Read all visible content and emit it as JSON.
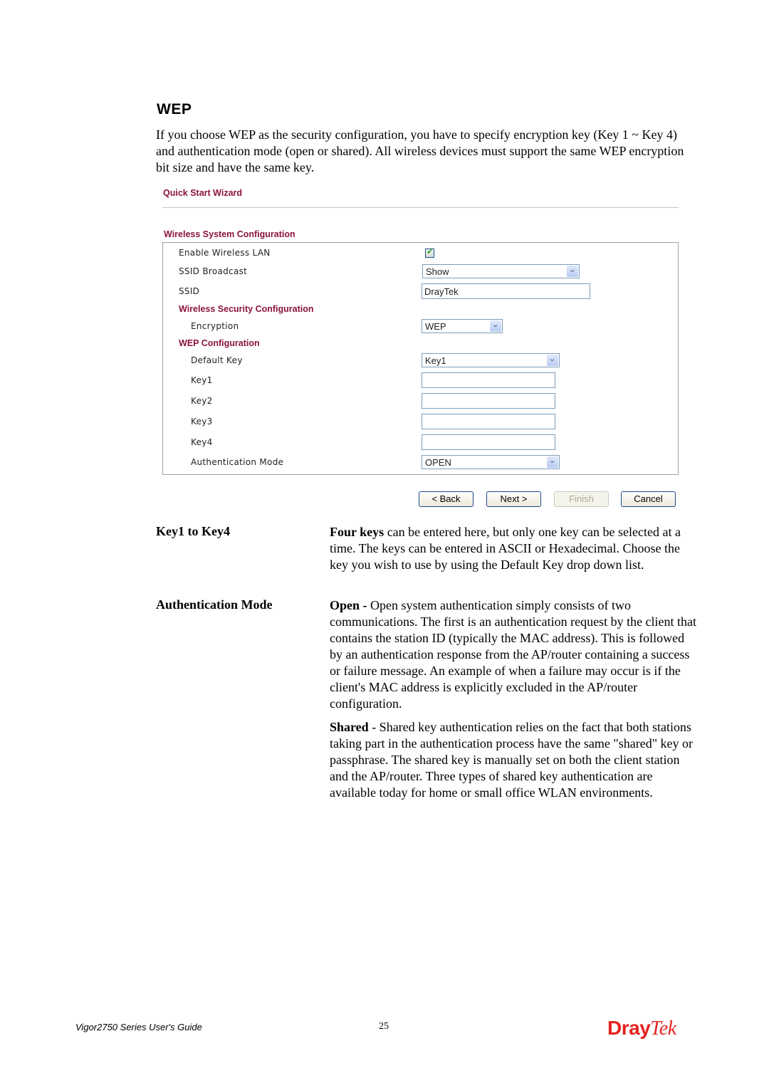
{
  "section": {
    "heading": "WEP",
    "intro": "If you choose WEP as the security configuration, you have to specify encryption key (Key 1 ~ Key 4) and authentication mode (open or shared). All wireless devices must support the same WEP encryption bit size and have the same key."
  },
  "wizard": {
    "title": "Quick Start Wizard",
    "system_section": "Wireless System Configuration",
    "security_section": "Wireless Security Configuration",
    "wep_section": "WEP Configuration",
    "fields": {
      "enable_wlan": {
        "label": "Enable Wireless LAN",
        "checked": true,
        "check_glyph": "✔"
      },
      "ssid_broadcast": {
        "label": "SSID Broadcast",
        "value": "Show"
      },
      "ssid": {
        "label": "SSID",
        "value": "DrayTek"
      },
      "encryption": {
        "label": "Encryption",
        "value": "WEP"
      },
      "default_key": {
        "label": "Default Key",
        "value": "Key1"
      },
      "key1": {
        "label": "Key1",
        "value": ""
      },
      "key2": {
        "label": "Key2",
        "value": ""
      },
      "key3": {
        "label": "Key3",
        "value": ""
      },
      "key4": {
        "label": "Key4",
        "value": ""
      },
      "auth_mode": {
        "label": "Authentication Mode",
        "value": "OPEN"
      }
    },
    "dropdown_glyph": "⌄",
    "buttons": {
      "back": "< Back",
      "next": "Next >",
      "finish": "Finish",
      "cancel": "Cancel"
    }
  },
  "definitions": {
    "keys": {
      "term": "Key1 to Key4",
      "bold": "Four keys",
      "text": " can be entered here, but only one key can be selected at a time. The keys can be entered in ASCII or Hexadecimal. Choose the key you wish to use by using the Default Key drop down list."
    },
    "auth": {
      "term": "Authentication Mode",
      "open_bold": "Open -",
      "open_text": " Open system authentication simply consists of two communications. The first is an authentication request by the client that contains the station ID (typically the MAC address). This is followed by an authentication response from the AP/router containing a success or failure message. An example of when a failure may occur is if the client's MAC address is explicitly excluded in the AP/router configuration.",
      "shared_bold": "Shared",
      "shared_text": " - Shared key authentication relies on the fact that both stations taking part in the authentication process have the same \"shared\" key or passphrase. The shared key is manually set on both the client station and the AP/router. Three types of shared key authentication are available today for home or small office WLAN environments."
    }
  },
  "footer": {
    "guide": "Vigor2750 Series User's Guide",
    "page_number": "25",
    "logo_bold": "Dray",
    "logo_italic": "Tek"
  }
}
